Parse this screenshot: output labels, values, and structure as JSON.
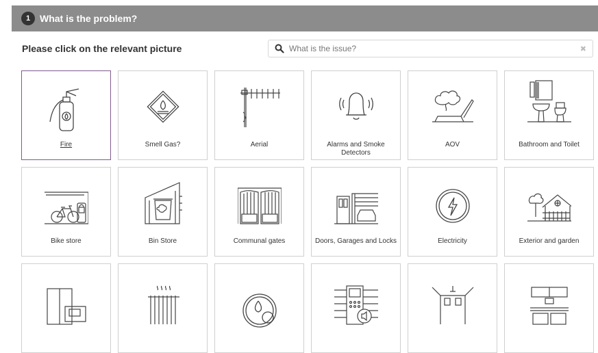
{
  "header": {
    "step": "1",
    "title": "What is the problem?"
  },
  "subtitle": "Please click on the relevant picture",
  "search": {
    "placeholder": "What is the issue?",
    "clear": "✖"
  },
  "tiles": [
    {
      "label": "Fire",
      "icon": "fire-extinguisher-icon",
      "selected": true
    },
    {
      "label": "Smell Gas?",
      "icon": "gas-warning-icon"
    },
    {
      "label": "Aerial",
      "icon": "aerial-icon"
    },
    {
      "label": "Alarms and Smoke Detectors",
      "icon": "alarm-bell-icon"
    },
    {
      "label": "AOV",
      "icon": "smoke-vent-icon"
    },
    {
      "label": "Bathroom and Toilet",
      "icon": "bathroom-icon"
    },
    {
      "label": "Bike store",
      "icon": "bike-store-icon"
    },
    {
      "label": "Bin Store",
      "icon": "bin-store-icon"
    },
    {
      "label": "Communal gates",
      "icon": "gates-icon"
    },
    {
      "label": "Doors, Garages and Locks",
      "icon": "doors-garage-icon"
    },
    {
      "label": "Electricity",
      "icon": "electricity-icon"
    },
    {
      "label": "Exterior and garden",
      "icon": "house-garden-icon"
    },
    {
      "label": "",
      "icon": "furniture-icon"
    },
    {
      "label": "",
      "icon": "radiator-icon"
    },
    {
      "label": "",
      "icon": "water-temperature-icon"
    },
    {
      "label": "",
      "icon": "intercom-icon"
    },
    {
      "label": "",
      "icon": "room-ceiling-icon"
    },
    {
      "label": "",
      "icon": "kitchen-icon"
    }
  ],
  "colors": {
    "header_bg": "#8c8c8c",
    "selected_border": "#7d5a8e",
    "line": "#444444"
  }
}
